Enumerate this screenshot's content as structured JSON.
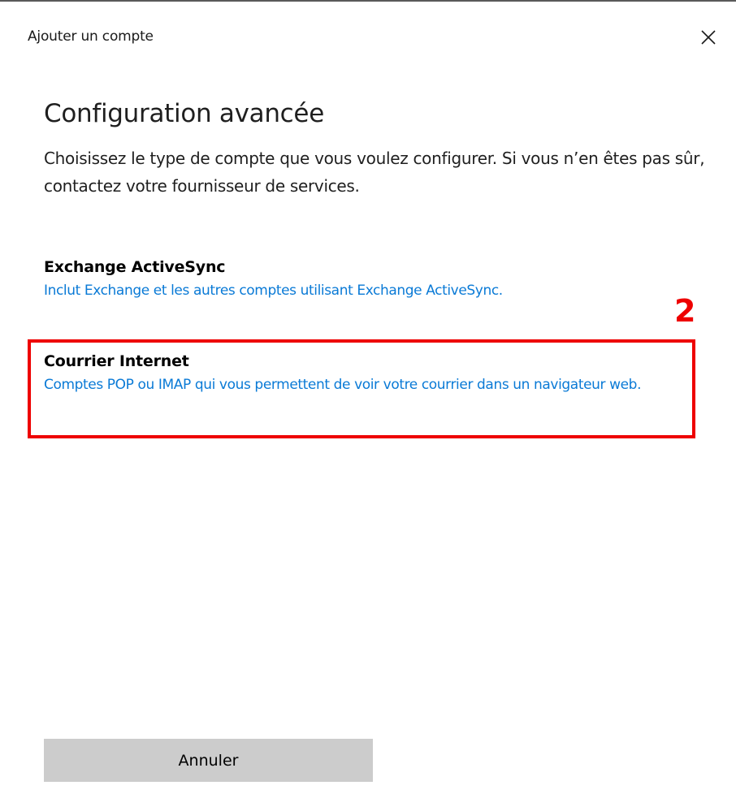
{
  "window": {
    "title": "Ajouter un compte",
    "close_icon": "close-icon"
  },
  "main": {
    "heading": "Configuration avancée",
    "description": "Choisissez le type de compte que vous voulez configurer. Si vous n’en êtes pas sûr, contactez votre fournisseur de services."
  },
  "options": [
    {
      "title": "Exchange ActiveSync",
      "subtitle": "Inclut Exchange et les autres comptes utilisant Exchange ActiveSync."
    },
    {
      "title": "Courrier Internet",
      "subtitle": "Comptes POP ou IMAP qui vous permettent de voir votre courrier dans un navigateur web.",
      "highlighted": true
    }
  ],
  "annotation": {
    "step_number": "2",
    "color": "#ee0000"
  },
  "footer": {
    "cancel_label": "Annuler"
  },
  "colors": {
    "link_blue": "#0a7ad6",
    "button_gray": "#cccccc"
  }
}
